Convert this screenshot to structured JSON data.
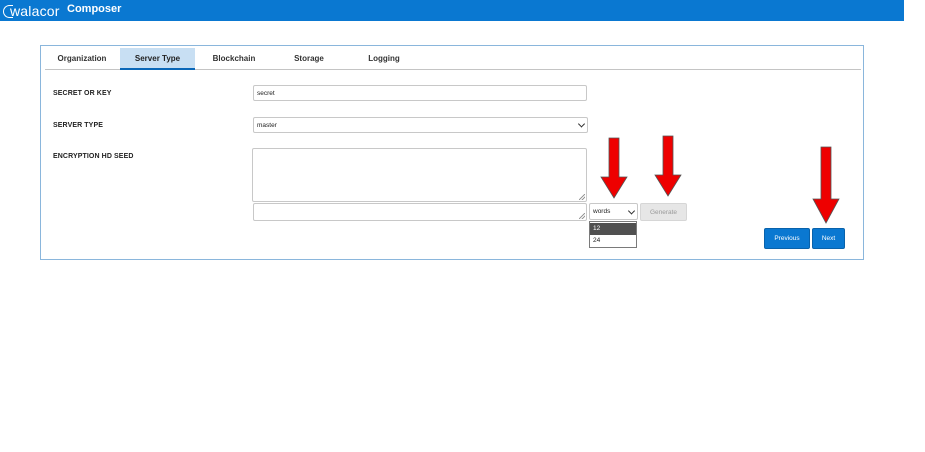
{
  "header": {
    "logo_text": "walacor",
    "app_title": "Composer",
    "brand_color": "#0a78d1"
  },
  "tabs": [
    {
      "label": "Organization",
      "active": false
    },
    {
      "label": "Server Type",
      "active": true
    },
    {
      "label": "Blockchain",
      "active": false
    },
    {
      "label": "Storage",
      "active": false
    },
    {
      "label": "Logging",
      "active": false
    }
  ],
  "form": {
    "secret": {
      "label": "SECRET OR KEY",
      "value": "secret"
    },
    "server_type": {
      "label": "SERVER TYPE",
      "value": "master"
    },
    "seed": {
      "label": "ENCRYPTION HD SEED",
      "words_select": "words",
      "words_options": [
        "12",
        "24"
      ],
      "selected_option": "12",
      "generate_label": "Generate"
    }
  },
  "buttons": {
    "previous": "Previous",
    "next": "Next"
  },
  "annotations": {
    "arrow_color": "#ee0000",
    "arrow_count": 3
  }
}
